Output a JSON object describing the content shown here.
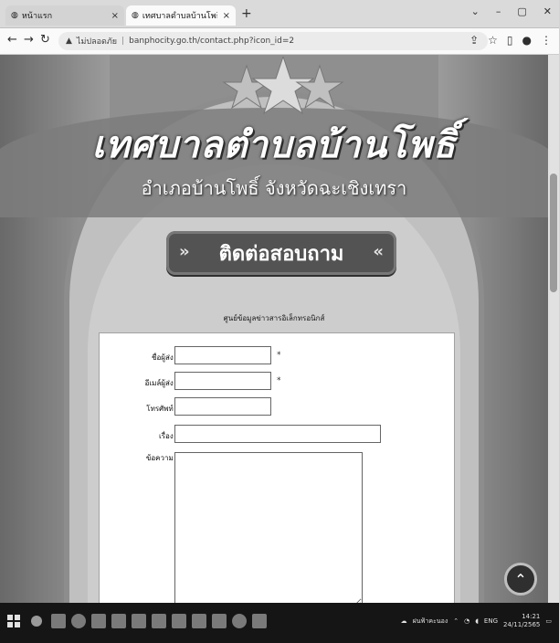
{
  "browser": {
    "tabs": [
      {
        "label": "หน้าแรก",
        "active": false
      },
      {
        "label": "เทศบาลตำบลบ้านโพธิ์ อ.บ้านโพธิ์ จ.ฉ",
        "active": true
      }
    ],
    "new_tab": "+",
    "address": {
      "security": "ไม่ปลอดภัย",
      "url": "banphocity.go.th/contact.php?icon_id=2"
    }
  },
  "page": {
    "site_title": "เทศบาลตำบลบ้านโพธิ์",
    "site_subtitle": "อำเภอบ้านโพธิ์ จังหวัดฉะเชิงเทรา",
    "contact_banner": "ติดต่อสอบถาม",
    "info_heading": "ศูนย์ข้อมูลข่าวสารอิเล็กทรอนิกส์",
    "form": {
      "name_label": "ชื่อผู้ส่ง :",
      "email_label": "อีเมล์ผู้ส่ง :",
      "phone_label": "โทรศัพท์ :",
      "subject_label": "เรื่อง :",
      "message_label": "ข้อความ :",
      "required_mark": "*"
    },
    "scroll_top": "⌃"
  },
  "taskbar": {
    "tray_text": "ฝนฟ้าคะนอง",
    "lang": "ENG",
    "time": "14:21",
    "date": "24/11/2565"
  },
  "colors": {
    "page_bg": "#8e8e8e",
    "panel_bg": "#fbfbfb",
    "taskbar_bg": "#1a1a1a"
  }
}
